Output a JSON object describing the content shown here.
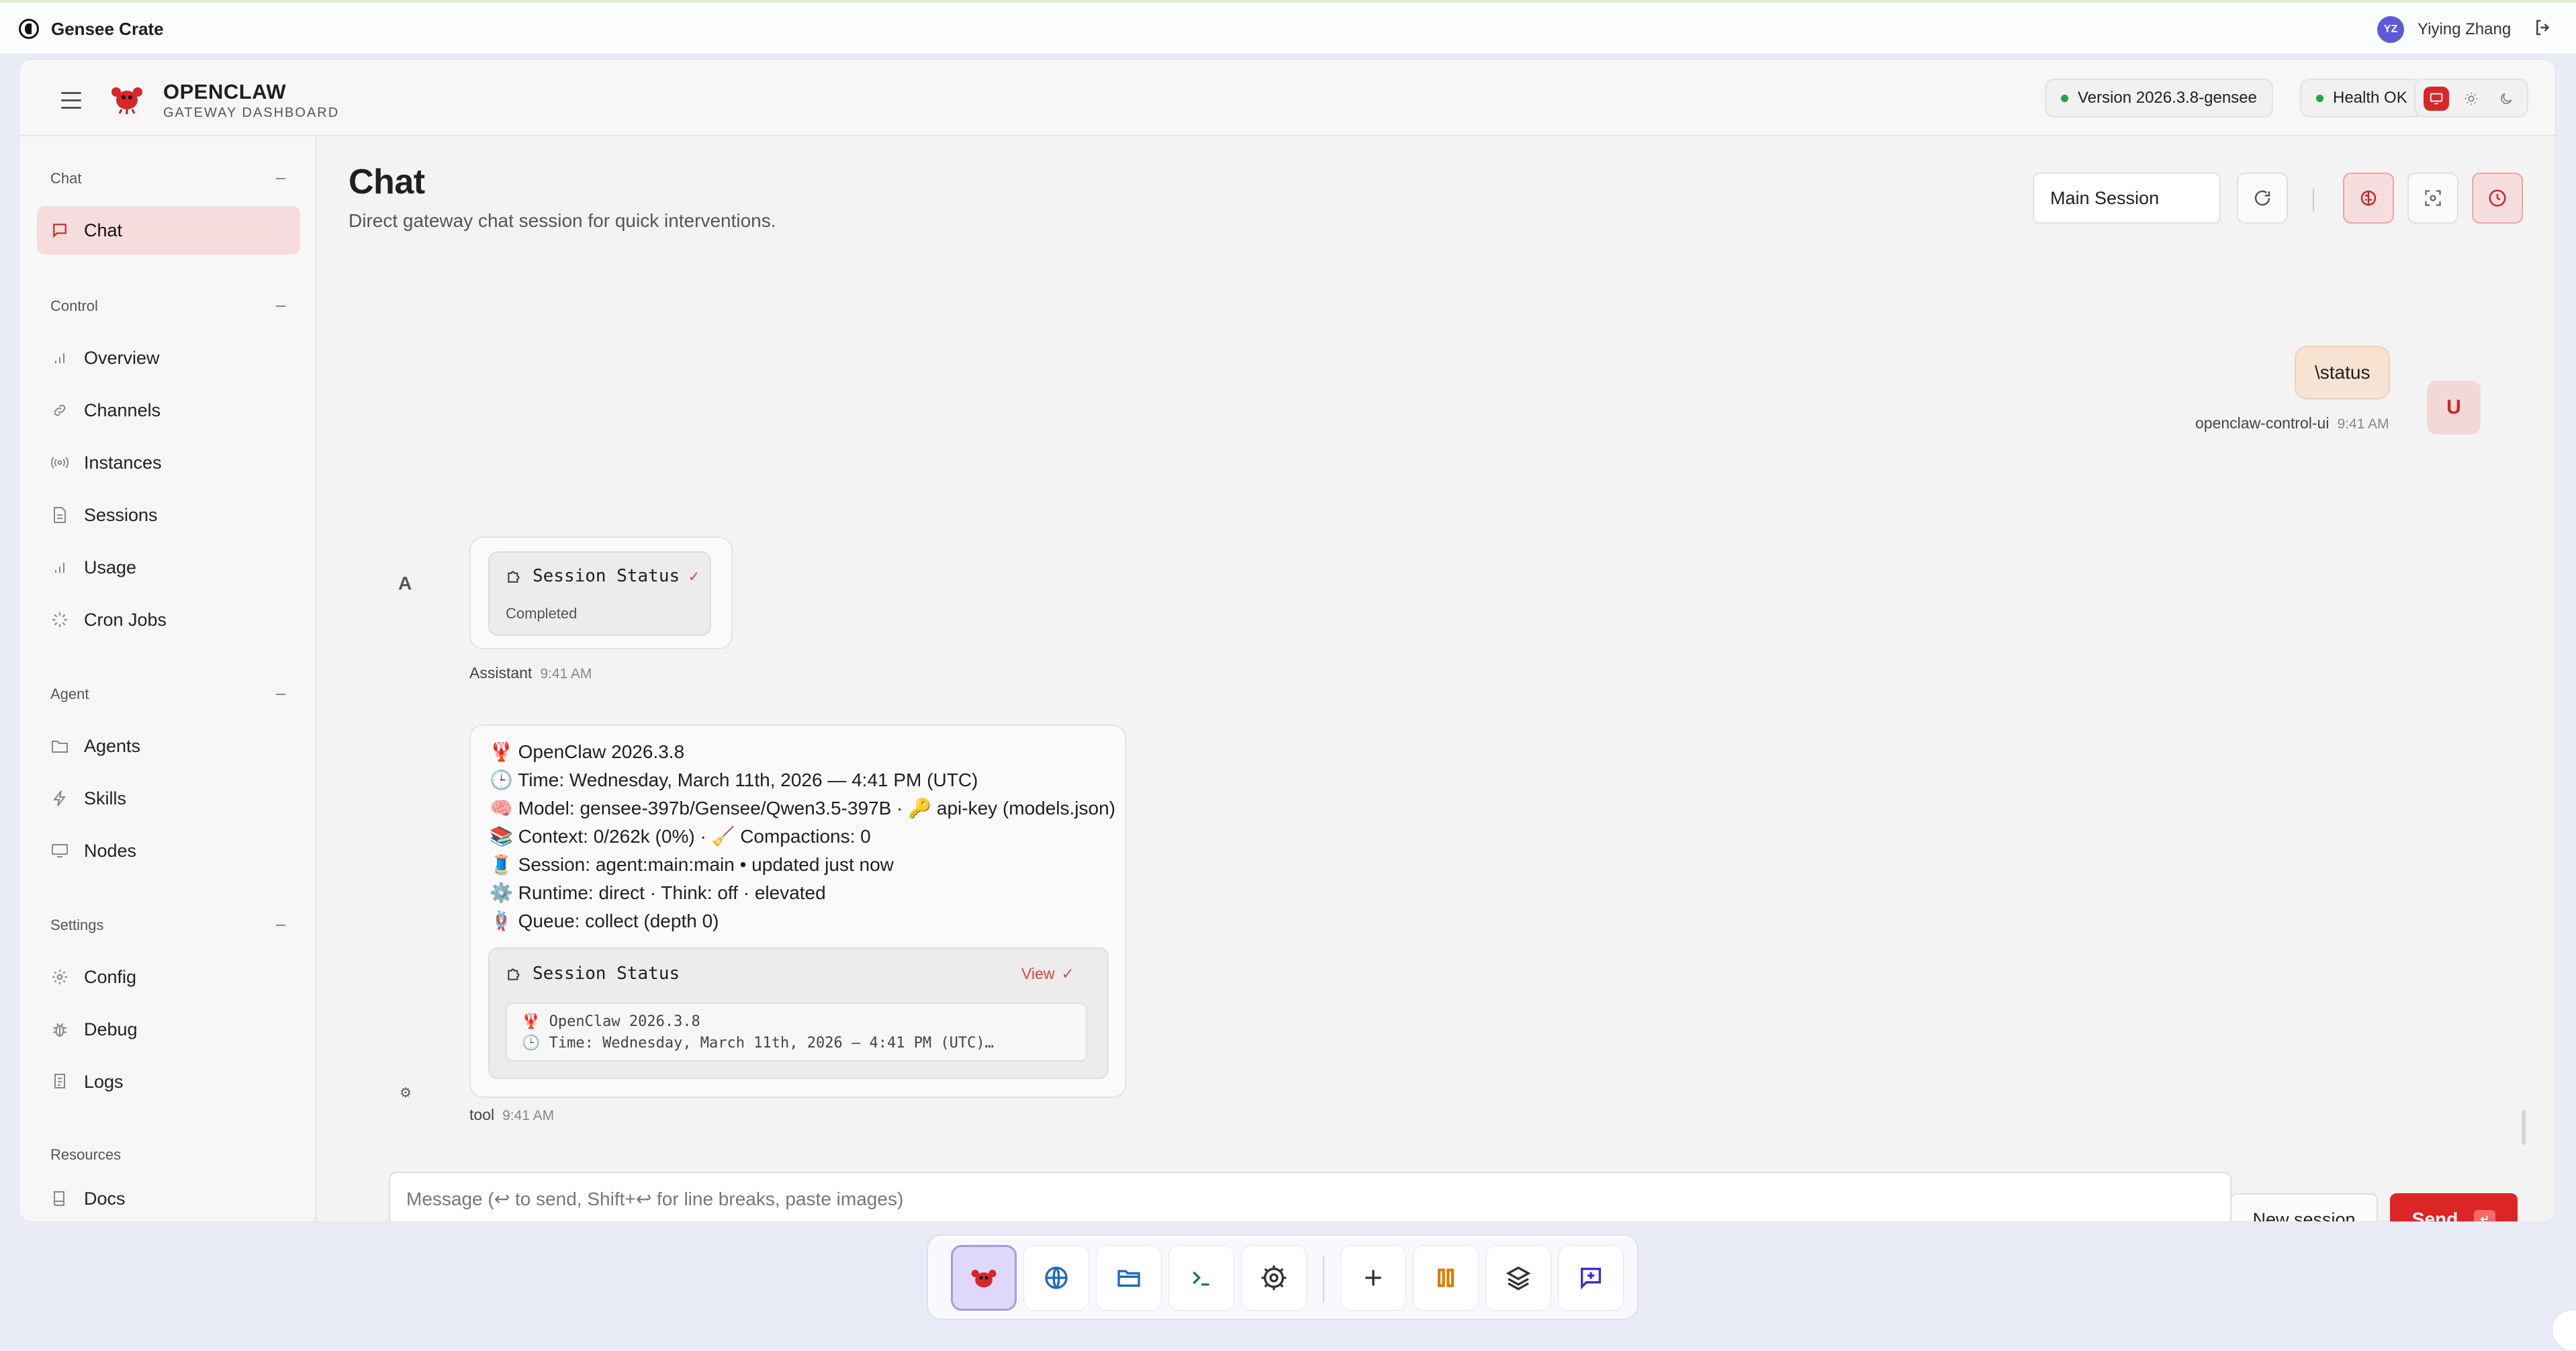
{
  "app": {
    "name": "Gensee Crate"
  },
  "user": {
    "initials": "YZ",
    "name": "Yiying Zhang"
  },
  "brand": {
    "title": "OPENCLAW",
    "subtitle": "GATEWAY DASHBOARD"
  },
  "header": {
    "version": "Version 2026.3.8-gensee",
    "health": "Health OK"
  },
  "sidebar": {
    "sections": [
      {
        "label": "Chat",
        "items": [
          {
            "label": "Chat",
            "icon": "chat-bubble-icon",
            "active": true
          }
        ]
      },
      {
        "label": "Control",
        "items": [
          {
            "label": "Overview",
            "icon": "bar-chart-icon"
          },
          {
            "label": "Channels",
            "icon": "link-icon"
          },
          {
            "label": "Instances",
            "icon": "radio-icon"
          },
          {
            "label": "Sessions",
            "icon": "document-icon"
          },
          {
            "label": "Usage",
            "icon": "bar-chart-icon"
          },
          {
            "label": "Cron Jobs",
            "icon": "loader-icon"
          }
        ]
      },
      {
        "label": "Agent",
        "items": [
          {
            "label": "Agents",
            "icon": "folder-icon"
          },
          {
            "label": "Skills",
            "icon": "lightning-icon"
          },
          {
            "label": "Nodes",
            "icon": "monitor-icon"
          }
        ]
      },
      {
        "label": "Settings",
        "items": [
          {
            "label": "Config",
            "icon": "gear-icon"
          },
          {
            "label": "Debug",
            "icon": "bug-icon"
          },
          {
            "label": "Logs",
            "icon": "scroll-icon"
          }
        ]
      },
      {
        "label": "Resources",
        "items": [
          {
            "label": "Docs",
            "icon": "book-icon"
          }
        ]
      }
    ]
  },
  "page": {
    "title": "Chat",
    "subtitle": "Direct gateway chat session for quick interventions."
  },
  "session_select": {
    "value": "Main Session"
  },
  "messages": {
    "user": {
      "text": "\\status",
      "sender": "openclaw-control-ui",
      "time": "9:41 AM",
      "avatar": "U"
    },
    "assistant": {
      "avatar": "A",
      "sender": "Assistant",
      "time": "9:41 AM",
      "tool_title": "Session Status",
      "tool_state": "Completed"
    },
    "tool": {
      "sender": "tool",
      "time": "9:41 AM",
      "avatar": "⚙",
      "lines": [
        "🦞 OpenClaw 2026.3.8",
        "🕒 Time: Wednesday, March 11th, 2026 — 4:41 PM (UTC)",
        "🧠 Model: gensee-397b/Gensee/Qwen3.5-397B · 🔑 api-key (models.json)",
        "📚 Context: 0/262k (0%) · 🧹 Compactions: 0",
        "🧵 Session: agent:main:main • updated just now",
        "⚙️ Runtime: direct · Think: off · elevated",
        "🪢 Queue: collect (depth 0)"
      ],
      "tool_title": "Session Status",
      "view_label": "View",
      "preview_lines": [
        "🦞 OpenClaw 2026.3.8",
        "🕒 Time: Wednesday, March 11th, 2026 — 4:41 PM (UTC)…"
      ]
    }
  },
  "composer": {
    "placeholder": "Message (↩ to send, Shift+↩ for line breaks, paste images)",
    "new_session": "New session",
    "send": "Send",
    "send_kbd": "↵"
  },
  "colors": {
    "accent": "#dc2626",
    "active_bg": "#f6dcdc",
    "health": "#1fa34a"
  }
}
